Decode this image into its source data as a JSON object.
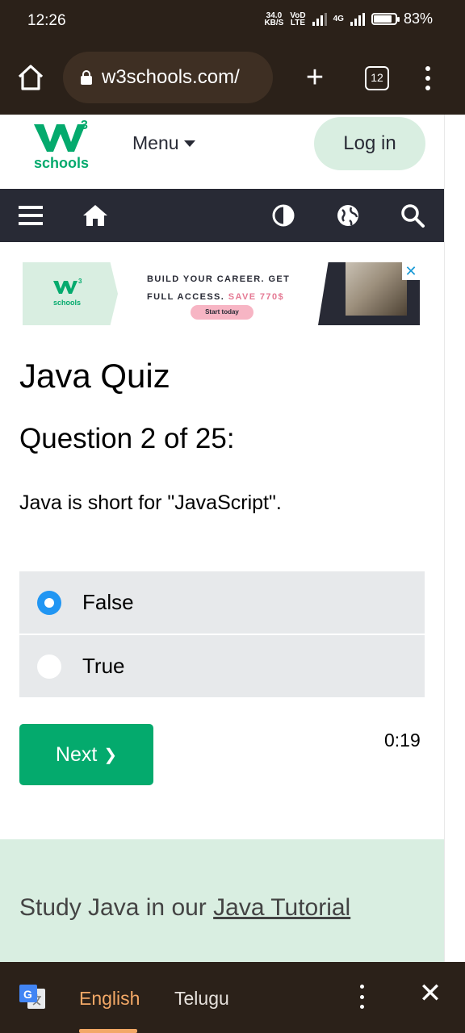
{
  "status_bar": {
    "time": "12:26",
    "net_speed_value": "34.0",
    "net_speed_unit": "KB/S",
    "volte_top": "VoD",
    "volte_bottom": "LTE",
    "network_type": "4G",
    "battery": "83%"
  },
  "browser": {
    "url": "w3schools.com/",
    "tab_count": "12"
  },
  "site": {
    "logo_text": "schools",
    "logo_sup": "3",
    "menu_label": "Menu",
    "login_label": "Log in"
  },
  "ad": {
    "logo_text": "schools",
    "line1": "BUILD YOUR CAREER. GET",
    "line2_prefix": "FULL ACCESS.",
    "line2_save": "SAVE 770$",
    "cta": "Start today"
  },
  "quiz": {
    "title": "Java Quiz",
    "question_heading": "Question 2 of 25:",
    "question_text": "Java is short for \"JavaScript\".",
    "options": [
      {
        "label": "False",
        "selected": true
      },
      {
        "label": "True",
        "selected": false
      }
    ],
    "next_label": "Next",
    "next_chevron": "❯",
    "timer": "0:19"
  },
  "footer": {
    "study_prefix": "Study Java in our",
    "study_link": "Java Tutorial"
  },
  "translate_bar": {
    "source_lang": "English",
    "target_lang": "Telugu"
  },
  "colors": {
    "brand_green": "#04aa6d",
    "mint": "#d9eee1",
    "nav_dark": "#282a35",
    "radio_blue": "#2196f3",
    "chrome_bg": "#2b2119",
    "translate_accent": "#f3a866"
  }
}
